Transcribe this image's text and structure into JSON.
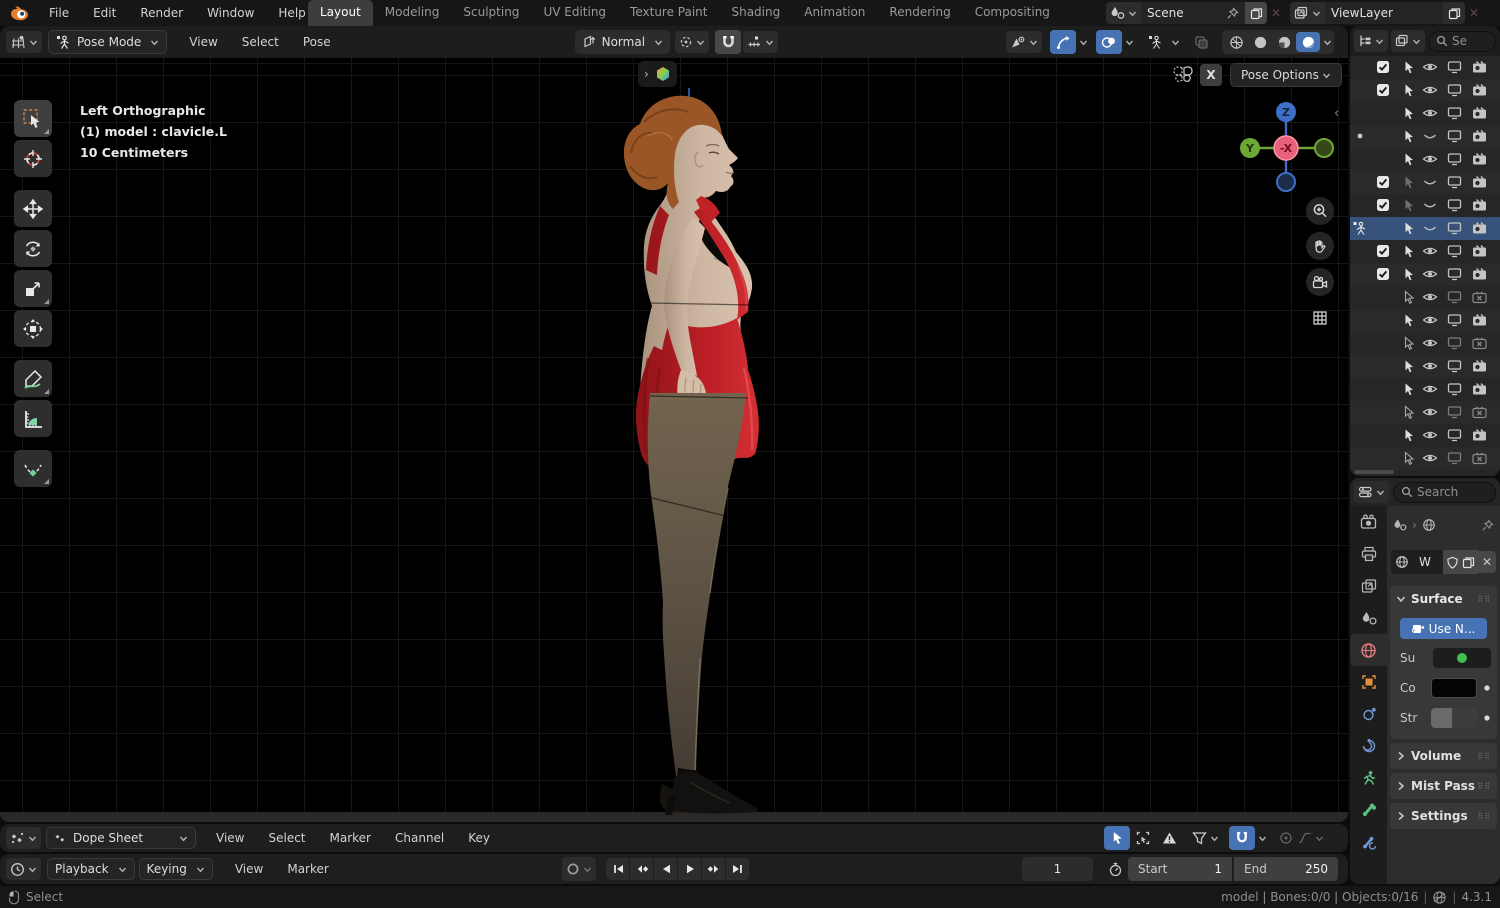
{
  "topbar": {
    "menus": [
      "File",
      "Edit",
      "Render",
      "Window",
      "Help"
    ],
    "workspaces": [
      "Layout",
      "Modeling",
      "Sculpting",
      "UV Editing",
      "Texture Paint",
      "Shading",
      "Animation",
      "Rendering",
      "Compositing"
    ],
    "active_workspace": "Layout",
    "scene": {
      "value": "Scene"
    },
    "view_layer": {
      "value": "ViewLayer"
    }
  },
  "tool_header": {
    "mode": "Pose Mode",
    "menus": [
      "View",
      "Select",
      "Pose"
    ],
    "orientation": "Normal"
  },
  "viewport": {
    "overlay_lines": [
      "Left Orthographic",
      "(1) model : clavicle.L",
      "10 Centimeters"
    ],
    "gizmo": {
      "top": "Z",
      "left": "Y",
      "center": "-X"
    },
    "float": {
      "close": "X",
      "pose_options": "Pose Options"
    },
    "tools": [
      {
        "name": "tweak-select",
        "active": true,
        "subtools": true
      },
      {
        "name": "cursor",
        "active": false,
        "subtools": false
      },
      {
        "gap": true
      },
      {
        "name": "move",
        "active": false,
        "subtools": false
      },
      {
        "name": "rotate",
        "active": false,
        "subtools": false
      },
      {
        "name": "scale",
        "active": false,
        "subtools": true
      },
      {
        "name": "transform",
        "active": false,
        "subtools": false
      },
      {
        "gap": true
      },
      {
        "name": "annotate",
        "active": false,
        "subtools": true
      },
      {
        "name": "measure",
        "active": false,
        "subtools": false
      },
      {
        "gap": true
      },
      {
        "name": "pose-breakdowner",
        "active": false,
        "subtools": true
      }
    ]
  },
  "outliner": {
    "search_placeholder": "Se",
    "rows": [
      {
        "leading": "none",
        "checkbox": true,
        "arrow": "solid",
        "eye": "open",
        "monitor": "on",
        "camera": "on",
        "selected": false
      },
      {
        "leading": "none",
        "checkbox": true,
        "arrow": "solid",
        "eye": "open",
        "monitor": "on",
        "camera": "on",
        "selected": false
      },
      {
        "leading": "none",
        "checkbox": false,
        "arrow": "solid",
        "eye": "open",
        "monitor": "on",
        "camera": "on",
        "selected": false
      },
      {
        "leading": "dot",
        "checkbox": false,
        "arrow": "solid",
        "eye": "closed",
        "monitor": "on",
        "camera": "on",
        "selected": false
      },
      {
        "leading": "none",
        "checkbox": false,
        "arrow": "solid",
        "eye": "open",
        "monitor": "on",
        "camera": "on",
        "selected": false
      },
      {
        "leading": "none",
        "checkbox": true,
        "arrow": "faded",
        "eye": "closed",
        "monitor": "on",
        "camera": "on",
        "selected": false
      },
      {
        "leading": "none",
        "checkbox": true,
        "arrow": "faded",
        "eye": "closed",
        "monitor": "on",
        "camera": "on",
        "selected": false
      },
      {
        "leading": "armature",
        "checkbox": false,
        "arrow": "solid",
        "eye": "closed",
        "monitor": "on",
        "camera": "on",
        "selected": true
      },
      {
        "leading": "none",
        "checkbox": true,
        "arrow": "solid",
        "eye": "open",
        "monitor": "on",
        "camera": "on",
        "selected": false
      },
      {
        "leading": "none",
        "checkbox": true,
        "arrow": "solid",
        "eye": "open",
        "monitor": "on",
        "camera": "on",
        "selected": false
      },
      {
        "leading": "none",
        "checkbox": false,
        "arrow": "outline",
        "eye": "open",
        "monitor": "dim",
        "camera": "off",
        "selected": false
      },
      {
        "leading": "none",
        "checkbox": false,
        "arrow": "solid",
        "eye": "open",
        "monitor": "on",
        "camera": "on",
        "selected": false
      },
      {
        "leading": "none",
        "checkbox": false,
        "arrow": "outline",
        "eye": "open",
        "monitor": "dim",
        "camera": "off",
        "selected": false
      },
      {
        "leading": "none",
        "checkbox": false,
        "arrow": "solid",
        "eye": "open",
        "monitor": "on",
        "camera": "on",
        "selected": false
      },
      {
        "leading": "none",
        "checkbox": false,
        "arrow": "solid",
        "eye": "open",
        "monitor": "on",
        "camera": "on",
        "selected": false
      },
      {
        "leading": "none",
        "checkbox": false,
        "arrow": "outline",
        "eye": "open",
        "monitor": "dim",
        "camera": "off",
        "selected": false
      },
      {
        "leading": "none",
        "checkbox": false,
        "arrow": "solid",
        "eye": "open",
        "monitor": "on",
        "camera": "on",
        "selected": false
      },
      {
        "leading": "none",
        "checkbox": false,
        "arrow": "outline",
        "eye": "open",
        "monitor": "dim",
        "camera": "off",
        "selected": false
      }
    ]
  },
  "properties": {
    "search_placeholder": "Search",
    "tabs": [
      "render",
      "output",
      "view-layer",
      "scene",
      "world",
      "object",
      "physics",
      "constraints",
      "data",
      "bone",
      "bone-constraints"
    ],
    "active_tab": "world",
    "block_name": "W",
    "surface": {
      "title": "Surface",
      "use_nodes_label": "Use N...",
      "rows": [
        {
          "label": "Su",
          "widget": "green-dot"
        },
        {
          "label": "Co",
          "widget": "color-black"
        },
        {
          "label": "Str",
          "widget": "slider"
        }
      ]
    },
    "collapsed_panels": [
      "Volume",
      "Mist Pass",
      "Settings"
    ]
  },
  "dope_sheet": {
    "mode": "Dope Sheet",
    "menus": [
      "View",
      "Select",
      "Marker",
      "Channel",
      "Key"
    ]
  },
  "timeline": {
    "dropdowns": [
      "Playback",
      "Keying"
    ],
    "menus": [
      "View",
      "Marker"
    ],
    "frame": "1",
    "start_label": "Start",
    "start_value": "1",
    "end_label": "End",
    "end_value": "250"
  },
  "status_bar": {
    "left": "Select",
    "info": [
      "model",
      "Bones:0/0",
      "Objects:0/16"
    ],
    "version": "4.3.1"
  },
  "colors": {
    "accent": "#4772b3",
    "selection_row": "#37537c",
    "dress_red": "#b92025",
    "axis_x": "#e0566e",
    "axis_y": "#6ca933",
    "axis_z": "#3d6fc9"
  }
}
